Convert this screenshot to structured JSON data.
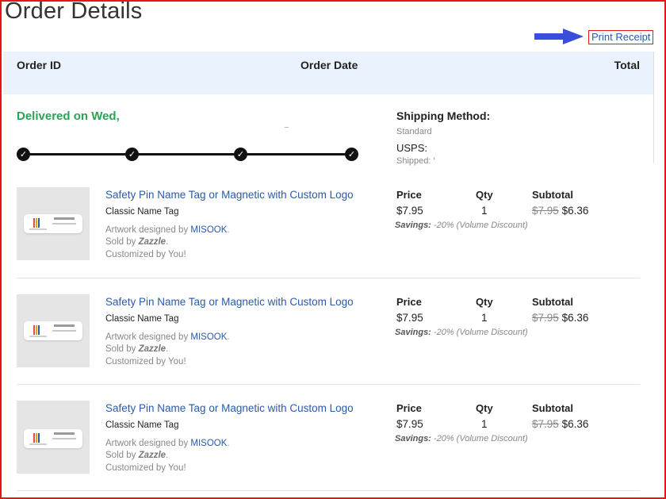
{
  "page": {
    "title": "Order Details",
    "print_receipt": "Print Receipt"
  },
  "header": {
    "order_id": "Order ID",
    "order_date": "Order Date",
    "total": "Total"
  },
  "status": {
    "delivered": "Delivered on Wed,"
  },
  "progress": {
    "steps_completed": 4,
    "step_icon": "check-icon"
  },
  "shipping": {
    "title": "Shipping Method:",
    "method": "Standard",
    "carrier": "USPS:",
    "shipped": "Shipped: '"
  },
  "columns": {
    "price": "Price",
    "qty": "Qty",
    "subtotal": "Subtotal"
  },
  "items": [
    {
      "title": "Safety Pin Name Tag or Magnetic with Custom Logo",
      "type": "Classic Name Tag",
      "artwork_prefix": "Artwork designed by ",
      "artist": "MISOOK",
      "artwork_suffix": ".",
      "sold_prefix": "Sold by ",
      "seller": "Zazzle",
      "sold_suffix": ".",
      "customized": "Customized by You!",
      "price": "$7.95",
      "qty": "1",
      "original": "$7.95",
      "subtotal": "$6.36",
      "savings_label": "Savings:",
      "savings_detail": " -20% (Volume Discount)"
    },
    {
      "title": "Safety Pin Name Tag or Magnetic with Custom Logo",
      "type": "Classic Name Tag",
      "artwork_prefix": "Artwork designed by ",
      "artist": "MISOOK",
      "artwork_suffix": ".",
      "sold_prefix": "Sold by ",
      "seller": "Zazzle",
      "sold_suffix": ".",
      "customized": "Customized by You!",
      "price": "$7.95",
      "qty": "1",
      "original": "$7.95",
      "subtotal": "$6.36",
      "savings_label": "Savings:",
      "savings_detail": " -20% (Volume Discount)"
    },
    {
      "title": "Safety Pin Name Tag or Magnetic with Custom Logo",
      "type": "Classic Name Tag",
      "artwork_prefix": "Artwork designed by ",
      "artist": "MISOOK",
      "artwork_suffix": ".",
      "sold_prefix": "Sold by ",
      "seller": "Zazzle",
      "sold_suffix": ".",
      "customized": "Customized by You!",
      "price": "$7.95",
      "qty": "1",
      "original": "$7.95",
      "subtotal": "$6.36",
      "savings_label": "Savings:",
      "savings_detail": " -20% (Volume Discount)"
    }
  ],
  "colors": {
    "link": "#2a5aa8",
    "delivered": "#2aa352",
    "header_bg": "#eaf3fd",
    "frame": "#e8141c",
    "arrow": "#3a4fd9"
  }
}
